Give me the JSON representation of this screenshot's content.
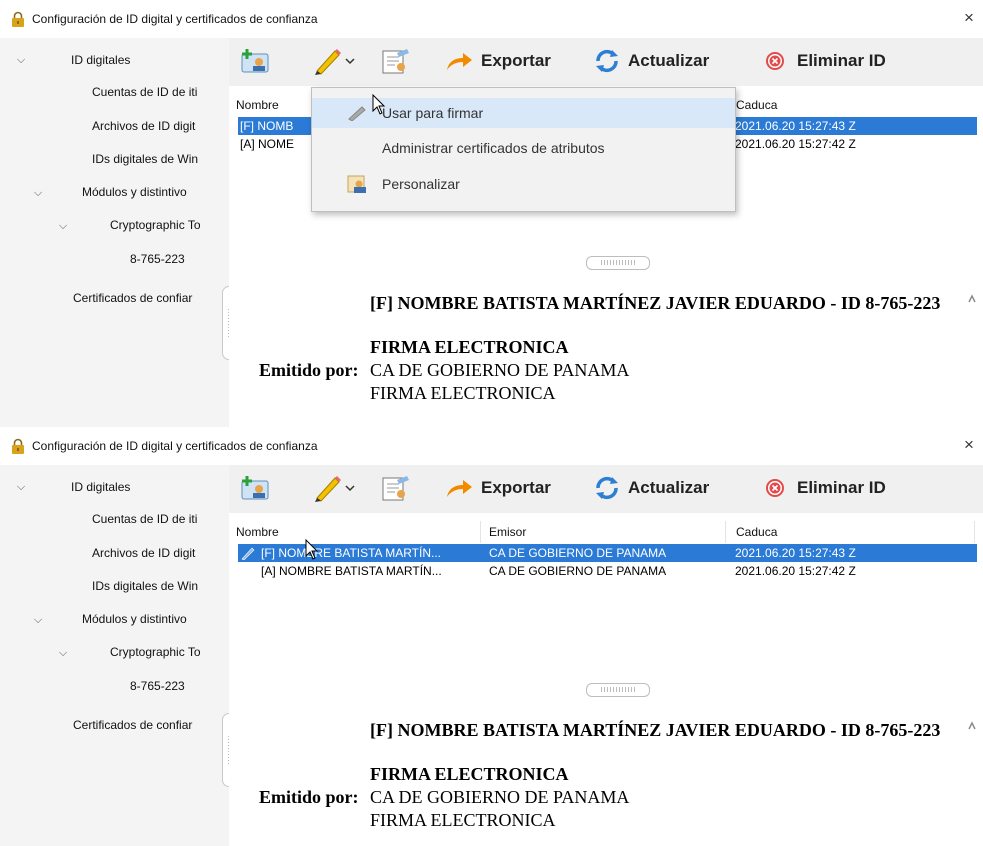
{
  "window": {
    "title": "Configuración de ID digital y certificados de confianza",
    "close_label": "×"
  },
  "sidebar": {
    "items": [
      {
        "label": "ID digitales",
        "chevron": "⌵"
      },
      {
        "label": "Cuentas de ID de iti"
      },
      {
        "label": "Archivos de ID digit"
      },
      {
        "label": "IDs digitales de Win"
      },
      {
        "label": "Módulos y distintivo",
        "chevron": "⌵"
      },
      {
        "label": "Cryptographic To",
        "chevron": "⌵"
      },
      {
        "label": "8-765-223"
      },
      {
        "label": "Certificados de confiar"
      }
    ]
  },
  "toolbar": {
    "add_id_icon": "add-id-icon",
    "sign_icon": "pen-icon",
    "dropdown_icon": "caret-down-icon",
    "certificate_icon": "certificate-icon",
    "export_label": "Exportar",
    "export_icon": "export-arrow-icon",
    "refresh_label": "Actualizar",
    "refresh_icon": "refresh-icon",
    "remove_label": "Eliminar ID",
    "remove_icon": "remove-circle-icon"
  },
  "table": {
    "columns": [
      "Nombre",
      "Emisor",
      "Caduca"
    ],
    "rows": [
      {
        "name": "[F] NOMBRE BATISTA MARTÍN...",
        "issuer": "CA DE GOBIERNO DE PANAMA",
        "expires": "2021.06.20 15:27:43 Z",
        "selected": true
      },
      {
        "name": "[A] NOMBRE BATISTA MARTÍN...",
        "issuer": "CA DE GOBIERNO DE PANAMA",
        "expires": "2021.06.20 15:27:42 Z",
        "selected": false
      }
    ],
    "panel1_rows": [
      {
        "name": "[F] NOMB",
        "expires": "2021.06.20 15:27:43 Z"
      },
      {
        "name": "[A] NOME",
        "expires": "2021.06.20 15:27:42 Z"
      }
    ],
    "panel1_partial_header": "Caduca"
  },
  "menu": {
    "items": [
      {
        "label": "Usar para firmar",
        "icon": "pen-icon",
        "state": "hover"
      },
      {
        "label": "Administrar certificados de atributos",
        "state": "normal"
      },
      {
        "label": "Personalizar",
        "icon": "personalize-icon",
        "state": "normal"
      }
    ]
  },
  "details": {
    "name": "[F] NOMBRE BATISTA MARTÍNEZ JAVIER EDUARDO - ID 8-765-223",
    "subtitle": "FIRMA ELECTRONICA",
    "issued_by_label": "Emitido por:",
    "issuer": "CA DE GOBIERNO DE PANAMA",
    "issuer_sub": "FIRMA ELECTRONICA"
  },
  "colors": {
    "selection": "#2b7bd6",
    "toolbar_bg": "#f0f0f0",
    "sidebar_bg": "#f4f4f4",
    "menu_hover": "#d9e8f8",
    "remove_icon": "#e14b4b",
    "export_icon": "#f28a00",
    "refresh_icon": "#2d7fd3"
  }
}
